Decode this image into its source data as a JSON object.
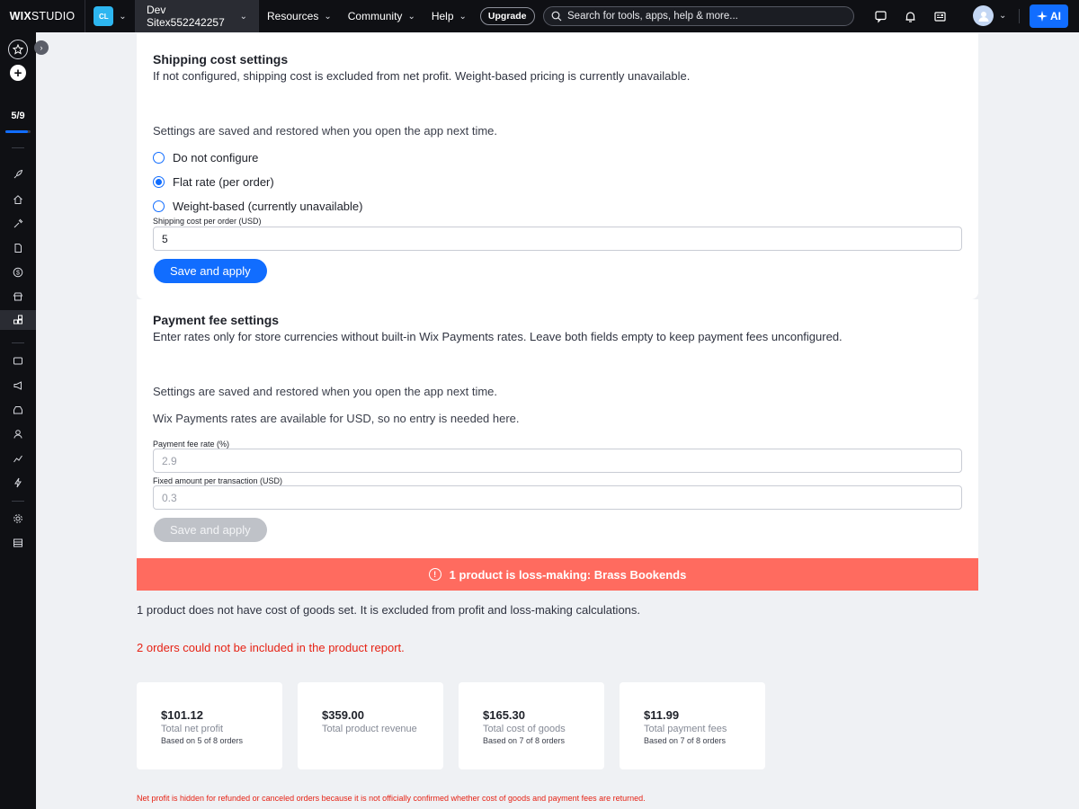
{
  "topbar": {
    "brand_bold": "WIX",
    "brand_light": "STUDIO",
    "site_badge": "CL",
    "site_name": "Dev Sitex552242257",
    "nav": [
      "Resources",
      "Community",
      "Help"
    ],
    "upgrade": "Upgrade",
    "search_placeholder": "Search for tools, apps, help & more...",
    "ai_label": "AI"
  },
  "rail": {
    "progress_label": "5/9",
    "progress_fraction": 0.9
  },
  "shipping": {
    "title": "Shipping cost settings",
    "subtitle": "If not configured, shipping cost is excluded from net profit. Weight-based pricing is currently unavailable.",
    "saved_note": "Settings are saved and restored when you open the app next time.",
    "options": [
      "Do not configure",
      "Flat rate (per order)",
      "Weight-based (currently unavailable)"
    ],
    "selected": "Flat rate (per order)",
    "field_label": "Shipping cost per order (USD)",
    "field_value": "5",
    "button": "Save and apply"
  },
  "payment": {
    "title": "Payment fee settings",
    "subtitle": "Enter rates only for store currencies without built-in Wix Payments rates. Leave both fields empty to keep payment fees unconfigured.",
    "saved_note": "Settings are saved and restored when you open the app next time.",
    "rates_note": "Wix Payments rates are available for USD, so no entry is needed here.",
    "rate_label": "Payment fee rate (%)",
    "rate_placeholder": "2.9",
    "fixed_label": "Fixed amount per transaction (USD)",
    "fixed_placeholder": "0.3",
    "button": "Save and apply"
  },
  "alert": {
    "icon": "!",
    "text": "1 product is loss-making: Brass Bookends"
  },
  "notes": {
    "cogs": "1 product does not have cost of goods set. It is excluded from profit and loss-making calculations.",
    "orders_error": "2 orders could not be included in the product report."
  },
  "stats": [
    {
      "value": "$101.12",
      "label": "Total net profit",
      "sub": "Based on 5 of 8 orders"
    },
    {
      "value": "$359.00",
      "label": "Total product revenue",
      "sub": ""
    },
    {
      "value": "$165.30",
      "label": "Total cost of goods",
      "sub": "Based on 7 of 8 orders"
    },
    {
      "value": "$11.99",
      "label": "Total payment fees",
      "sub": "Based on 7 of 8 orders"
    }
  ],
  "footnote": "Net profit is hidden for refunded or canceled orders because it is not officially confirmed whether cost of goods and payment fees are returned.",
  "colors": {
    "accent": "#116dff",
    "alert": "#ff6b5f",
    "error_text": "#e62214",
    "topbar": "#0f1014"
  }
}
